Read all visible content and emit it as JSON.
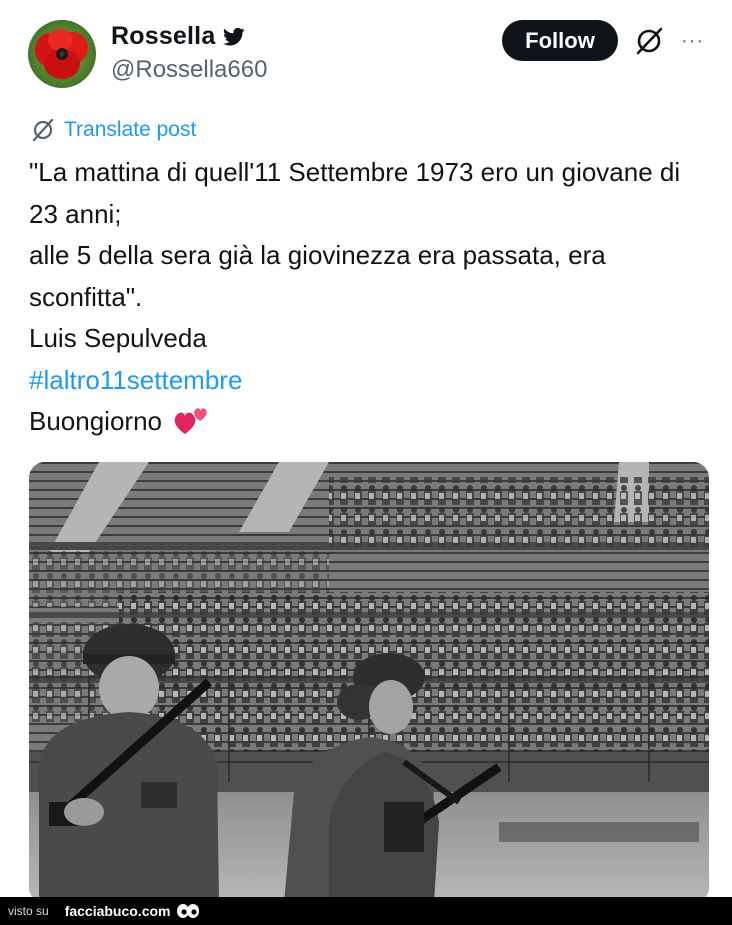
{
  "author": {
    "display_name": "Rossella",
    "handle": "@Rossella660",
    "verified_badge_icon": "twitter-bird-icon",
    "avatar_icon": "poppy-flower-avatar"
  },
  "header": {
    "follow_label": "Follow",
    "grok_icon": "grok-slash-icon",
    "more_icon": "more-horizontal-icon",
    "more_glyph": "···"
  },
  "translate": {
    "label": "Translate post",
    "icon": "translate-slash-icon"
  },
  "tweet": {
    "lines": [
      "\"La mattina di quell'11 Settembre 1973 ero un giovane di 23 anni;",
      "alle 5 della sera già la giovinezza era passata, era sconfitta\".",
      "Luis Sepulveda"
    ],
    "hashtag": "#laltro11settembre",
    "closing": "Buongiorno",
    "closing_emoji": "two-hearts-icon"
  },
  "media": {
    "description_icon": "stadium-soldiers-photo"
  },
  "watermark": {
    "prefix": "visto su",
    "site": "facciabuco.com",
    "logo_icon": "eyes-logo-icon"
  },
  "colors": {
    "link_blue": "#1d9bf0",
    "text": "#0f1419",
    "muted": "#536471",
    "follow_bg": "#0f1419"
  }
}
